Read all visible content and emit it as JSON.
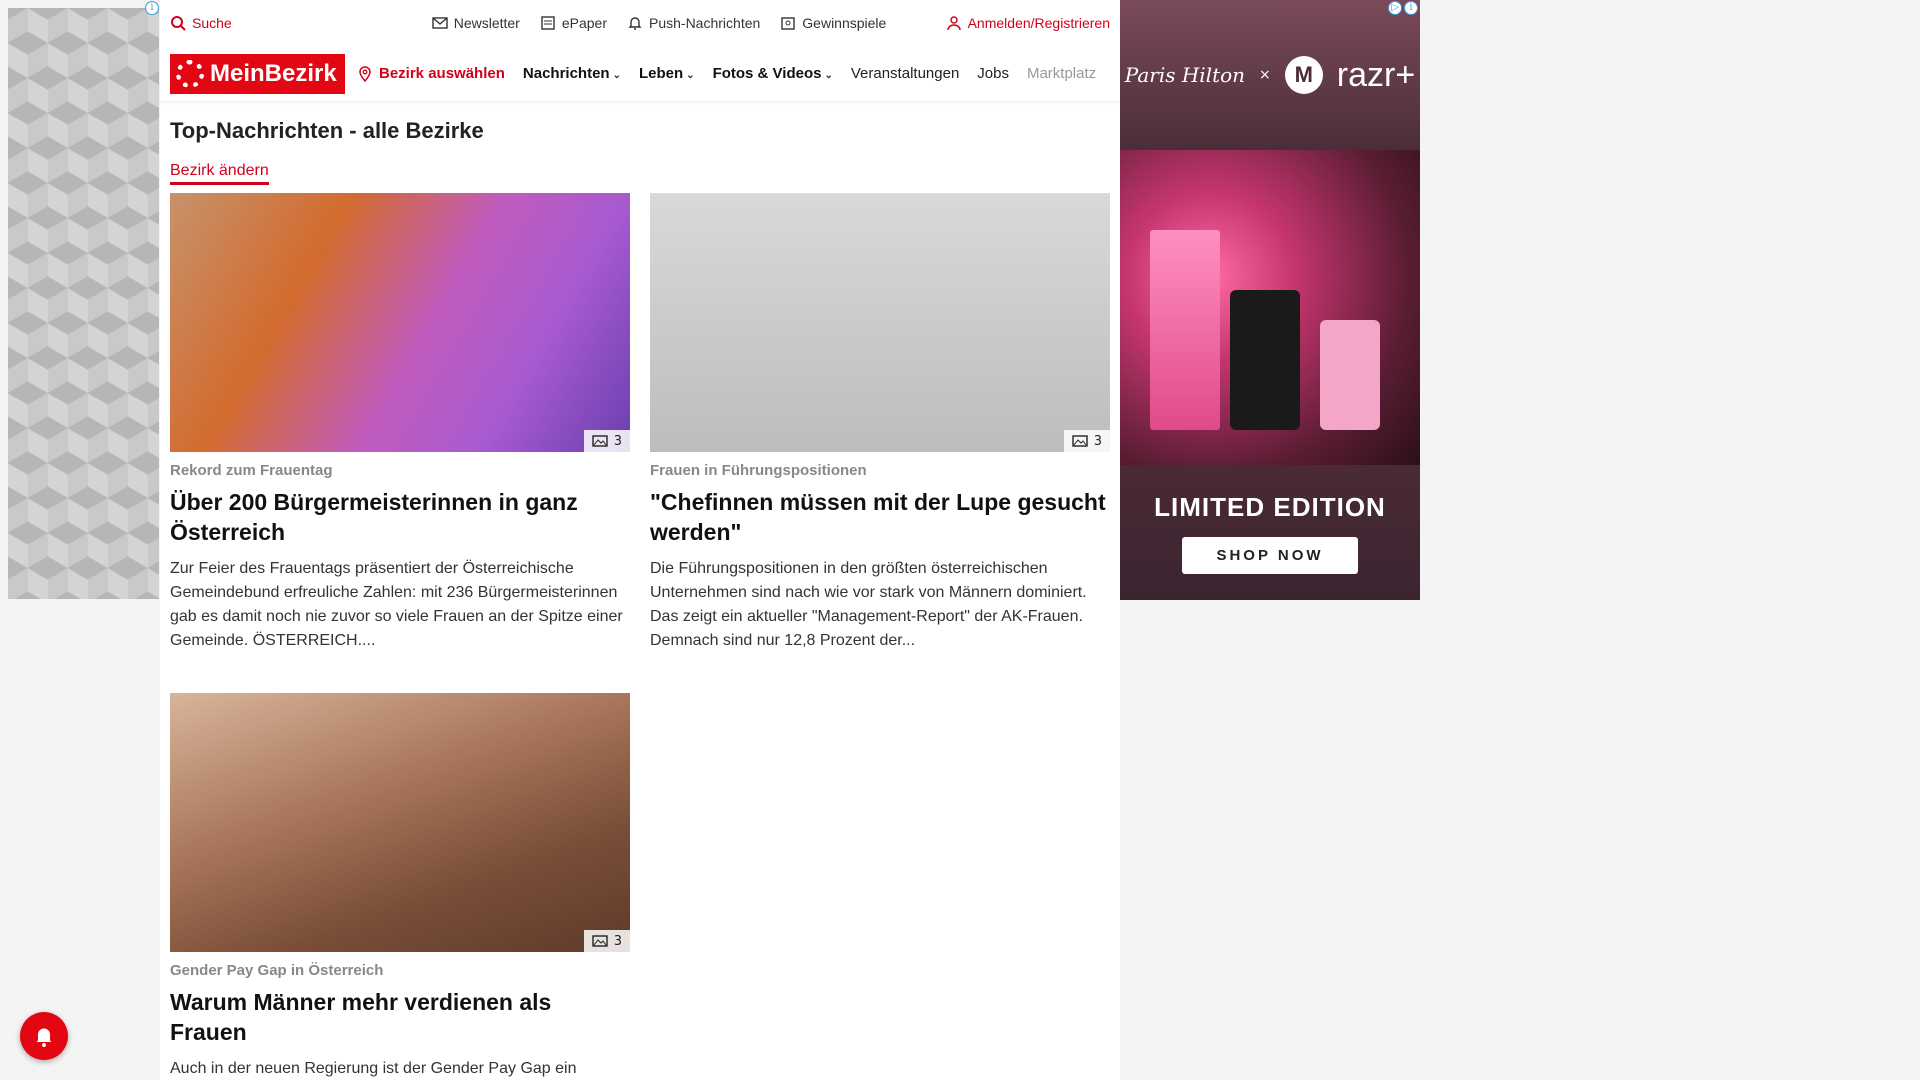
{
  "topbar": {
    "search_label": "Suche",
    "newsletter_label": "Newsletter",
    "epaper_label": "ePaper",
    "push_label": "Push-Nachrichten",
    "gewinnspiele_label": "Gewinnspiele",
    "login_label": "Anmelden/Registrieren"
  },
  "navbar": {
    "logo_text": "MeinBezirk",
    "bezirk_label": "Bezirk auswählen",
    "items": [
      {
        "label": "Nachrichten"
      },
      {
        "label": "Leben"
      },
      {
        "label": "Fotos & Videos"
      },
      {
        "label": "Veranstaltungen"
      },
      {
        "label": "Jobs"
      },
      {
        "label": "Marktplatz"
      }
    ]
  },
  "page": {
    "title": "Top-Nachrichten - alle Bezirke",
    "change_label": "Bezirk ändern"
  },
  "articles": [
    {
      "kicker": "Rekord zum Frauentag",
      "title": "Über 200 Bürgermeisterinnen in ganz Österreich",
      "teaser": "Zur Feier des Frauentags präsentiert der Österreichische Gemeindebund erfreuliche Zahlen: mit 236 Bürgermeisterinnen gab es damit noch nie zuvor so viele Frauen an der Spitze einer Gemeinde. ÖSTERREICH....",
      "gallery_count": "3"
    },
    {
      "kicker": "Frauen in Führungspositionen",
      "title": "\"Chefinnen müssen mit der Lupe gesucht werden\"",
      "teaser": "Die Führungspositionen in den größten österreichischen Unternehmen sind nach wie vor stark von Männern dominiert. Das zeigt ein aktueller \"Management-Report\" der AK-Frauen. Demnach sind nur 12,8 Prozent der...",
      "gallery_count": "3"
    },
    {
      "kicker": "Gender Pay Gap in Österreich",
      "title": "Warum Männer mehr verdienen als Frauen",
      "teaser": "Auch in der neuen Regierung ist der Gender Pay Gap ein",
      "gallery_count": "3"
    }
  ],
  "ad": {
    "brand_script": "Paris Hilton",
    "x_sep": "×",
    "moto_logo": "M",
    "razr_label": "razr+",
    "limited_label": "LIMITED EDITION",
    "shop_label": "SHOP NOW"
  },
  "icons": {
    "search": "search-icon",
    "newsletter": "mail-icon",
    "epaper": "newspaper-icon",
    "push": "bell-icon",
    "gewinnspiele": "gift-icon",
    "login": "user-icon",
    "bezirk": "location-pin-icon",
    "gallery": "image-icon"
  },
  "colors": {
    "accent": "#e30613",
    "kicker": "#888888"
  }
}
